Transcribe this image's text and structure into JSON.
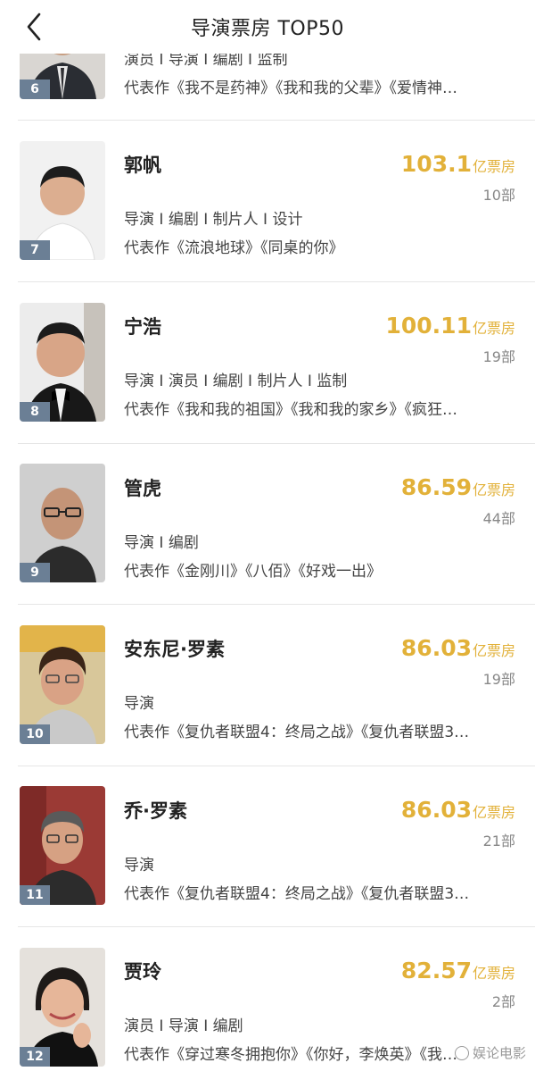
{
  "header": {
    "title": "导演票房 TOP50"
  },
  "rows": [
    {
      "rank": "6",
      "name": "",
      "gross": "",
      "unit": "",
      "films": "",
      "roles": "演员 I 导演 I 编剧 I 监制",
      "works": "代表作《我不是药神》《我和我的父辈》《爱情神…"
    },
    {
      "rank": "7",
      "name": "郭帆",
      "gross": "103.1",
      "unit": "亿票房",
      "films": "10部",
      "roles": "导演 I 编剧 I 制片人 I 设计",
      "works": "代表作《流浪地球》《同桌的你》"
    },
    {
      "rank": "8",
      "name": "宁浩",
      "gross": "100.11",
      "unit": "亿票房",
      "films": "19部",
      "roles": "导演 I 演员 I 编剧 I 制片人 I 监制",
      "works": "代表作《我和我的祖国》《我和我的家乡》《疯狂…"
    },
    {
      "rank": "9",
      "name": "管虎",
      "gross": "86.59",
      "unit": "亿票房",
      "films": "44部",
      "roles": "导演 I 编剧",
      "works": "代表作《金刚川》《八佰》《好戏一出》"
    },
    {
      "rank": "10",
      "name": "安东尼·罗素",
      "gross": "86.03",
      "unit": "亿票房",
      "films": "19部",
      "roles": "导演",
      "works": "代表作《复仇者联盟4：终局之战》《复仇者联盟3…"
    },
    {
      "rank": "11",
      "name": "乔·罗素",
      "gross": "86.03",
      "unit": "亿票房",
      "films": "21部",
      "roles": "导演",
      "works": "代表作《复仇者联盟4：终局之战》《复仇者联盟3…"
    },
    {
      "rank": "12",
      "name": "贾玲",
      "gross": "82.57",
      "unit": "亿票房",
      "films": "2部",
      "roles": "演员 I 导演 I 编剧",
      "works": "代表作《穿过寒冬拥抱你》《你好，李焕英》《我…"
    }
  ],
  "watermark": {
    "text": "娱论电影"
  },
  "colors": {
    "gross": "#e2b139",
    "rank_badge": "#6b7f95",
    "divider": "#e6e6e6"
  }
}
